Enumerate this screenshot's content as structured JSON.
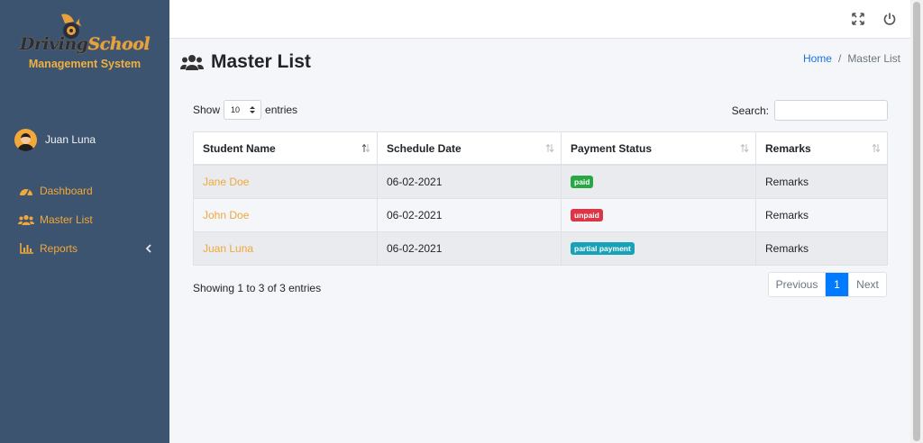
{
  "brand": {
    "title_part1": "Driving",
    "title_part2": "School",
    "subtitle": "Management System"
  },
  "user": {
    "name": "Juan Luna"
  },
  "sidebar": {
    "items": [
      {
        "label": "Dashboard",
        "icon": "dashboard-icon"
      },
      {
        "label": "Master List",
        "icon": "users-icon"
      },
      {
        "label": "Reports",
        "icon": "chart-icon"
      }
    ]
  },
  "page": {
    "title": "Master List"
  },
  "breadcrumb": {
    "home": "Home",
    "separator": "/",
    "current": "Master List"
  },
  "controls": {
    "show_label": "Show",
    "entries_value": "10",
    "entries_label": "entries",
    "search_label": "Search:",
    "search_value": ""
  },
  "table": {
    "headers": [
      "Student Name",
      "Schedule Date",
      "Payment Status",
      "Remarks"
    ],
    "rows": [
      {
        "name": "Jane Doe",
        "date": "06-02-2021",
        "status": "paid",
        "status_color": "#28a745",
        "remarks": "Remarks"
      },
      {
        "name": "John Doe",
        "date": "06-02-2021",
        "status": "unpaid",
        "status_color": "#dc3545",
        "remarks": "Remarks"
      },
      {
        "name": "Juan Luna",
        "date": "06-02-2021",
        "status": "partial payment",
        "status_color": "#17a2b8",
        "remarks": "Remarks"
      }
    ]
  },
  "footer": {
    "info": "Showing 1 to 3 of 3 entries",
    "prev": "Previous",
    "current_page": "1",
    "next": "Next"
  },
  "colors": {
    "sidebar": "#3d5470",
    "accent": "#f0a83a",
    "primary": "#007bff"
  }
}
